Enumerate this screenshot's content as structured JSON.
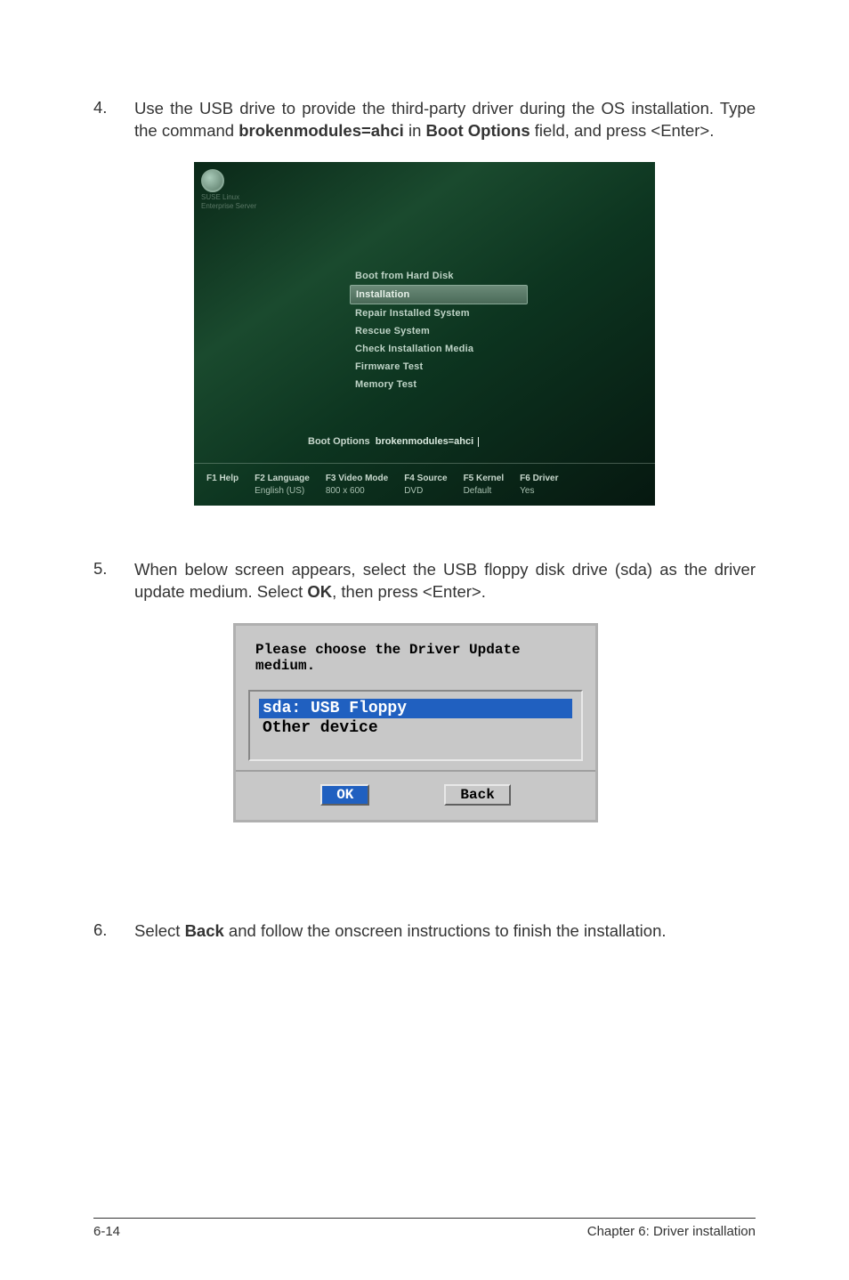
{
  "step4": {
    "num": "4.",
    "before_bold1": "Use the USB drive to provide the third-party driver during the OS installation. Type the command ",
    "bold1": "brokenmodules=ahci",
    "between1": " in ",
    "bold2": "Boot Options",
    "after_bold2": " field, and press <Enter>."
  },
  "boot": {
    "logo_line1": "SUSE Linux",
    "logo_line2": "Enterprise Server",
    "menu": {
      "items": [
        "Boot from Hard Disk",
        "Installation",
        "Repair Installed System",
        "Rescue System",
        "Check Installation Media",
        "Firmware Test",
        "Memory Test"
      ],
      "selected_index": 1
    },
    "options_label": "Boot Options",
    "options_value": "brokenmodules=ahci",
    "fkeys": [
      {
        "label": "F1 Help",
        "value": ""
      },
      {
        "label": "F2 Language",
        "value": "English (US)"
      },
      {
        "label": "F3 Video Mode",
        "value": "800 x 600"
      },
      {
        "label": "F4 Source",
        "value": "DVD"
      },
      {
        "label": "F5 Kernel",
        "value": "Default"
      },
      {
        "label": "F6 Driver",
        "value": "Yes"
      }
    ]
  },
  "step5": {
    "num": "5.",
    "before_bold": "When below screen appears, select the USB floppy disk drive (sda) as the driver update medium. Select ",
    "bold": "OK",
    "after_bold": ", then press <Enter>."
  },
  "dialog": {
    "title": "Please choose the Driver Update medium.",
    "items": [
      "sda: USB Floppy",
      "Other device"
    ],
    "selected_index": 0,
    "ok": "OK",
    "back": "Back"
  },
  "step6": {
    "num": "6.",
    "before_bold": "Select ",
    "bold": "Back",
    "after_bold": " and follow the onscreen instructions to finish the installation."
  },
  "footer": {
    "left": "6-14",
    "right": "Chapter 6: Driver installation"
  }
}
